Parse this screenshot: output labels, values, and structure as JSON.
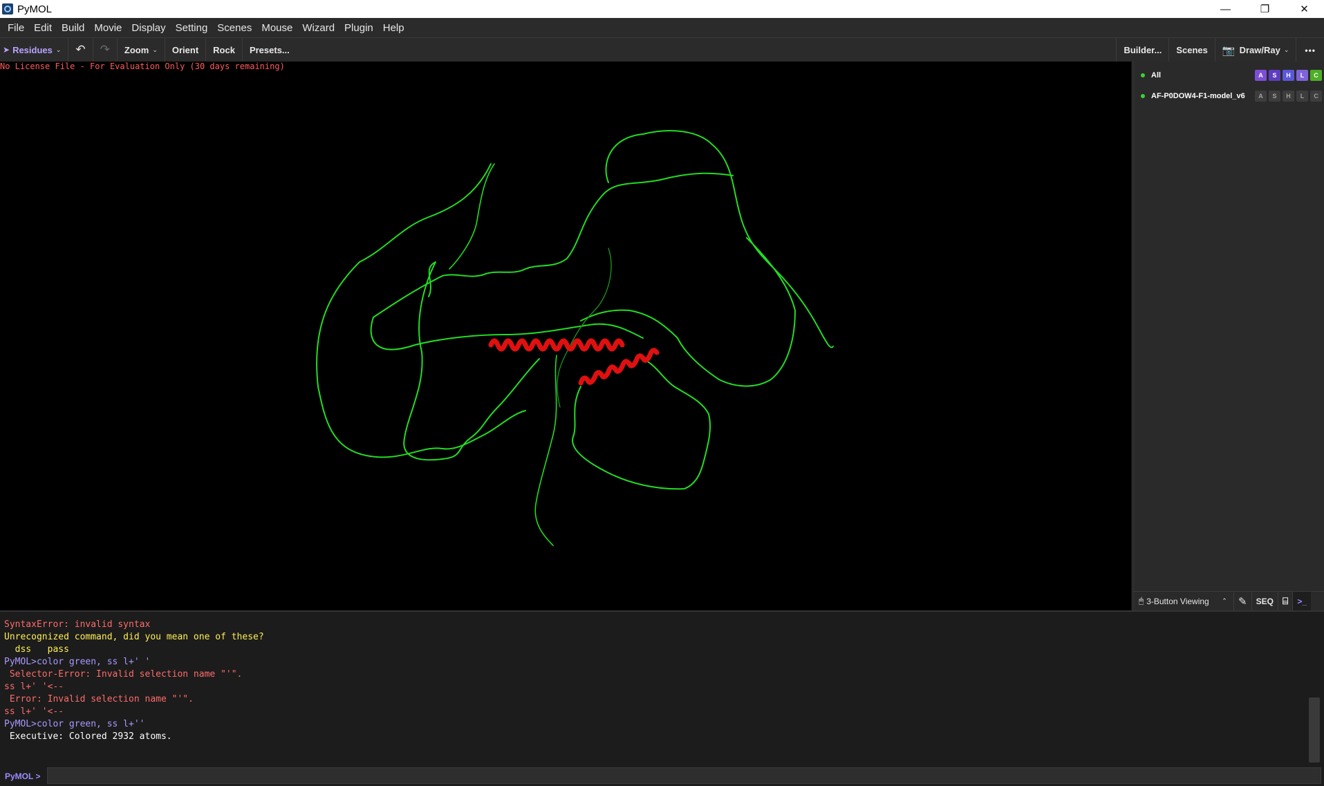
{
  "window": {
    "title": "PyMOL",
    "controls": [
      "—",
      "❐",
      "✕"
    ]
  },
  "menu": [
    "File",
    "Edit",
    "Build",
    "Movie",
    "Display",
    "Setting",
    "Scenes",
    "Mouse",
    "Wizard",
    "Plugin",
    "Help"
  ],
  "toolbar": {
    "residues_label": "Residues",
    "undo_icon": "↶",
    "redo_icon": "↷",
    "zoom_label": "Zoom",
    "orient_label": "Orient",
    "rock_label": "Rock",
    "presets_label": "Presets...",
    "builder_label": "Builder...",
    "scenes_label": "Scenes",
    "drawray_label": "Draw/Ray",
    "more_label": "•••"
  },
  "viewer": {
    "license_text": "No License File - For Evaluation Only (30 days remaining)",
    "background": "#000000",
    "coil_color": "#22dd22",
    "helix_color": "#e01010"
  },
  "objects": [
    {
      "name": "All",
      "buttons": [
        "A",
        "S",
        "H",
        "L",
        "C"
      ],
      "colored": true
    },
    {
      "name": "AF-P0DOW4-F1-model_v6",
      "buttons": [
        "A",
        "S",
        "H",
        "L",
        "C"
      ],
      "colored": false
    }
  ],
  "side_bottom": {
    "mouse_mode": "3-Button Viewing",
    "seq_label": "SEQ",
    "terminal_icon": ">_"
  },
  "console": {
    "lines": [
      {
        "text": "SyntaxError: invalid syntax",
        "color": "#ff6b6b"
      },
      {
        "text": "Unrecognized command, did you mean one of these?",
        "color": "#ffee55"
      },
      {
        "text": "  dss   pass",
        "color": "#ffee55"
      },
      {
        "text": "PyMOL>color green, ss l+' '",
        "color": "#a999ff"
      },
      {
        "text": " Selector-Error: Invalid selection name \"'\".",
        "color": "#ff6b6b"
      },
      {
        "text": "ss l+' '<--",
        "color": "#ff6b6b"
      },
      {
        "text": " Error: Invalid selection name \"'\".",
        "color": "#ff6b6b"
      },
      {
        "text": "ss l+' '<--",
        "color": "#ff6b6b"
      },
      {
        "text": "PyMOL>color green, ss l+''",
        "color": "#a999ff"
      },
      {
        "text": " Executive: Colored 2932 atoms.",
        "color": "#ffffff"
      }
    ]
  },
  "command": {
    "prompt": "PyMOL >",
    "value": ""
  }
}
